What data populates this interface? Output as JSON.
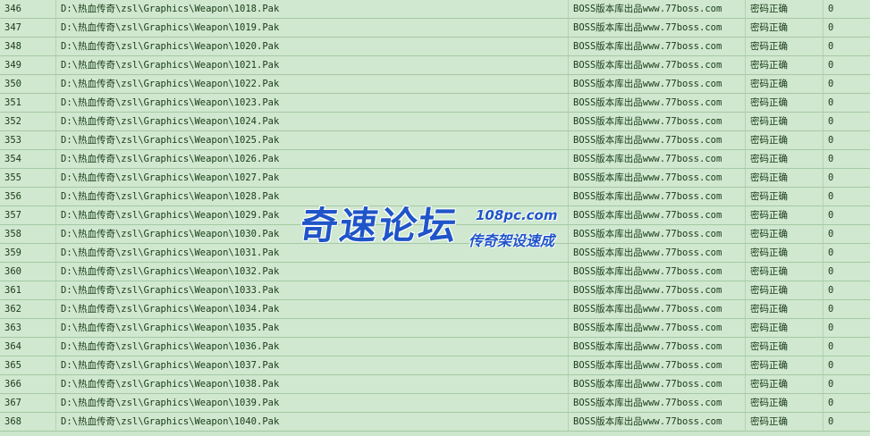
{
  "rows": [
    {
      "id": "346",
      "path": "D:\\热血传奇\\zsl\\Graphics\\Weapon\\1018.Pak",
      "source": "BOSS版本库出品www.77boss.com",
      "status": "密码正确",
      "flag": "0"
    },
    {
      "id": "347",
      "path": "D:\\热血传奇\\zsl\\Graphics\\Weapon\\1019.Pak",
      "source": "BOSS版本库出品www.77boss.com",
      "status": "密码正确",
      "flag": "0"
    },
    {
      "id": "348",
      "path": "D:\\热血传奇\\zsl\\Graphics\\Weapon\\1020.Pak",
      "source": "BOSS版本库出品www.77boss.com",
      "status": "密码正确",
      "flag": "0"
    },
    {
      "id": "349",
      "path": "D:\\热血传奇\\zsl\\Graphics\\Weapon\\1021.Pak",
      "source": "BOSS版本库出品www.77boss.com",
      "status": "密码正确",
      "flag": "0"
    },
    {
      "id": "350",
      "path": "D:\\热血传奇\\zsl\\Graphics\\Weapon\\1022.Pak",
      "source": "BOSS版本库出品www.77boss.com",
      "status": "密码正确",
      "flag": "0"
    },
    {
      "id": "351",
      "path": "D:\\热血传奇\\zsl\\Graphics\\Weapon\\1023.Pak",
      "source": "BOSS版本库出品www.77boss.com",
      "status": "密码正确",
      "flag": "0"
    },
    {
      "id": "352",
      "path": "D:\\热血传奇\\zsl\\Graphics\\Weapon\\1024.Pak",
      "source": "BOSS版本库出品www.77boss.com",
      "status": "密码正确",
      "flag": "0"
    },
    {
      "id": "353",
      "path": "D:\\热血传奇\\zsl\\Graphics\\Weapon\\1025.Pak",
      "source": "BOSS版本库出品www.77boss.com",
      "status": "密码正确",
      "flag": "0"
    },
    {
      "id": "354",
      "path": "D:\\热血传奇\\zsl\\Graphics\\Weapon\\1026.Pak",
      "source": "BOSS版本库出品www.77boss.com",
      "status": "密码正确",
      "flag": "0"
    },
    {
      "id": "355",
      "path": "D:\\热血传奇\\zsl\\Graphics\\Weapon\\1027.Pak",
      "source": "BOSS版本库出品www.77boss.com",
      "status": "密码正确",
      "flag": "0"
    },
    {
      "id": "356",
      "path": "D:\\热血传奇\\zsl\\Graphics\\Weapon\\1028.Pak",
      "source": "BOSS版本库出品www.77boss.com",
      "status": "密码正确",
      "flag": "0"
    },
    {
      "id": "357",
      "path": "D:\\热血传奇\\zsl\\Graphics\\Weapon\\1029.Pak",
      "source": "BOSS版本库出品www.77boss.com",
      "status": "密码正确",
      "flag": "0"
    },
    {
      "id": "358",
      "path": "D:\\热血传奇\\zsl\\Graphics\\Weapon\\1030.Pak",
      "source": "BOSS版本库出品www.77boss.com",
      "status": "密码正确",
      "flag": "0"
    },
    {
      "id": "359",
      "path": "D:\\热血传奇\\zsl\\Graphics\\Weapon\\1031.Pak",
      "source": "BOSS版本库出品www.77boss.com",
      "status": "密码正确",
      "flag": "0"
    },
    {
      "id": "360",
      "path": "D:\\热血传奇\\zsl\\Graphics\\Weapon\\1032.Pak",
      "source": "BOSS版本库出品www.77boss.com",
      "status": "密码正确",
      "flag": "0"
    },
    {
      "id": "361",
      "path": "D:\\热血传奇\\zsl\\Graphics\\Weapon\\1033.Pak",
      "source": "BOSS版本库出品www.77boss.com",
      "status": "密码正确",
      "flag": "0"
    },
    {
      "id": "362",
      "path": "D:\\热血传奇\\zsl\\Graphics\\Weapon\\1034.Pak",
      "source": "BOSS版本库出品www.77boss.com",
      "status": "密码正确",
      "flag": "0"
    },
    {
      "id": "363",
      "path": "D:\\热血传奇\\zsl\\Graphics\\Weapon\\1035.Pak",
      "source": "BOSS版本库出品www.77boss.com",
      "status": "密码正确",
      "flag": "0"
    },
    {
      "id": "364",
      "path": "D:\\热血传奇\\zsl\\Graphics\\Weapon\\1036.Pak",
      "source": "BOSS版本库出品www.77boss.com",
      "status": "密码正确",
      "flag": "0"
    },
    {
      "id": "365",
      "path": "D:\\热血传奇\\zsl\\Graphics\\Weapon\\1037.Pak",
      "source": "BOSS版本库出品www.77boss.com",
      "status": "密码正确",
      "flag": "0"
    },
    {
      "id": "366",
      "path": "D:\\热血传奇\\zsl\\Graphics\\Weapon\\1038.Pak",
      "source": "BOSS版本库出品www.77boss.com",
      "status": "密码正确",
      "flag": "0"
    },
    {
      "id": "367",
      "path": "D:\\热血传奇\\zsl\\Graphics\\Weapon\\1039.Pak",
      "source": "BOSS版本库出品www.77boss.com",
      "status": "密码正确",
      "flag": "0"
    },
    {
      "id": "368",
      "path": "D:\\热血传奇\\zsl\\Graphics\\Weapon\\1040.Pak",
      "source": "BOSS版本库出品www.77boss.com",
      "status": "密码正确",
      "flag": "0"
    }
  ],
  "watermark": {
    "main": "奇速论坛",
    "domain": "108pc.com",
    "sub": "传奇架设速成"
  },
  "colors": {
    "row_bg": "#cfe8cf",
    "grid_line": "#a6c9a6",
    "text": "#1a3a1a",
    "watermark": "#1f55c8"
  }
}
